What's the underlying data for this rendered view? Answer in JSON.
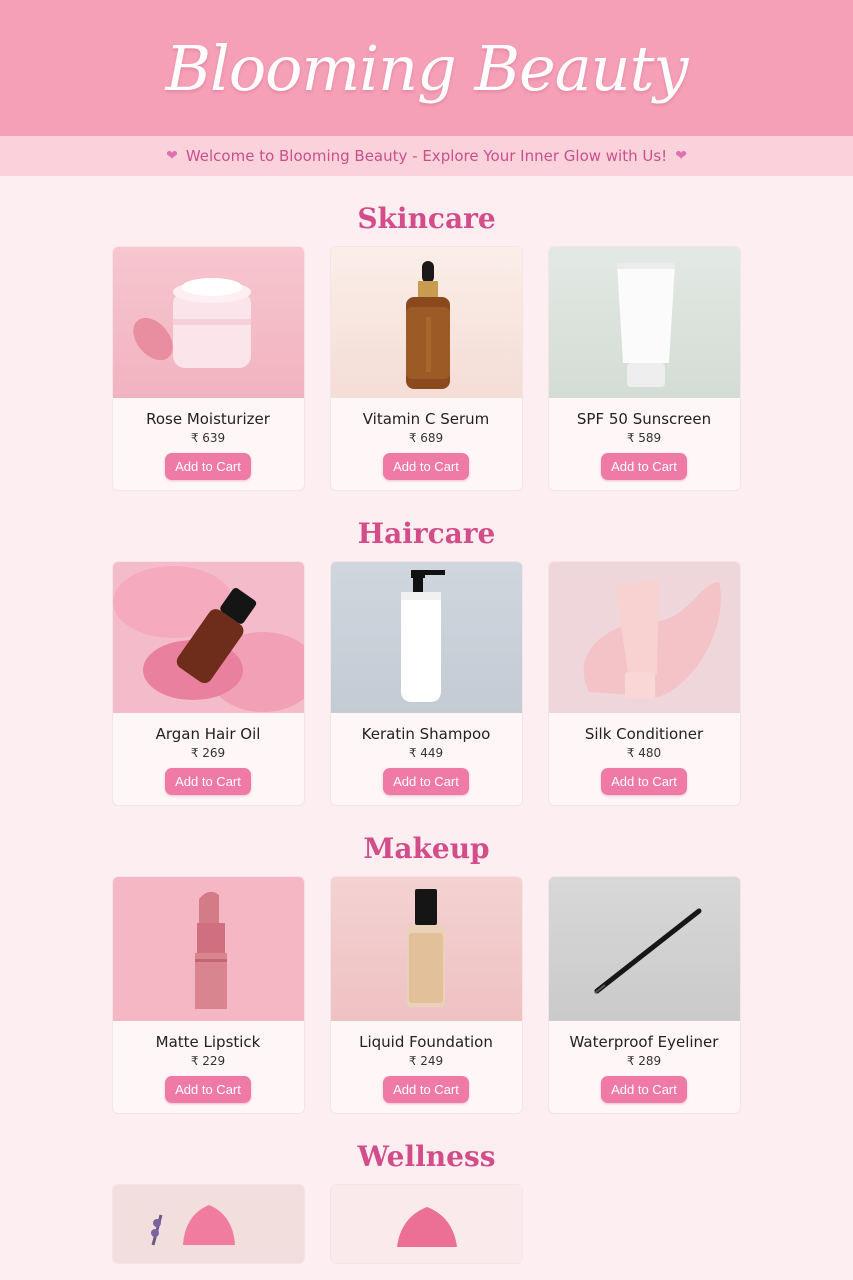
{
  "brand": "Blooming Beauty",
  "welcome": "Welcome to Blooming Beauty - Explore Your Inner Glow with Us!",
  "button_label": "Add to Cart",
  "sections": [
    {
      "title": "Skincare",
      "products": [
        {
          "name": "Rose Moisturizer",
          "price": "₹ 639"
        },
        {
          "name": "Vitamin C Serum",
          "price": "₹ 689"
        },
        {
          "name": "SPF 50 Sunscreen",
          "price": "₹ 589"
        }
      ]
    },
    {
      "title": "Haircare",
      "products": [
        {
          "name": "Argan Hair Oil",
          "price": "₹ 269"
        },
        {
          "name": "Keratin Shampoo",
          "price": "₹ 449"
        },
        {
          "name": "Silk Conditioner",
          "price": "₹ 480"
        }
      ]
    },
    {
      "title": "Makeup",
      "products": [
        {
          "name": "Matte Lipstick",
          "price": "₹ 229"
        },
        {
          "name": "Liquid Foundation",
          "price": "₹ 249"
        },
        {
          "name": "Waterproof Eyeliner",
          "price": "₹ 289"
        }
      ]
    },
    {
      "title": "Wellness",
      "products": []
    }
  ]
}
